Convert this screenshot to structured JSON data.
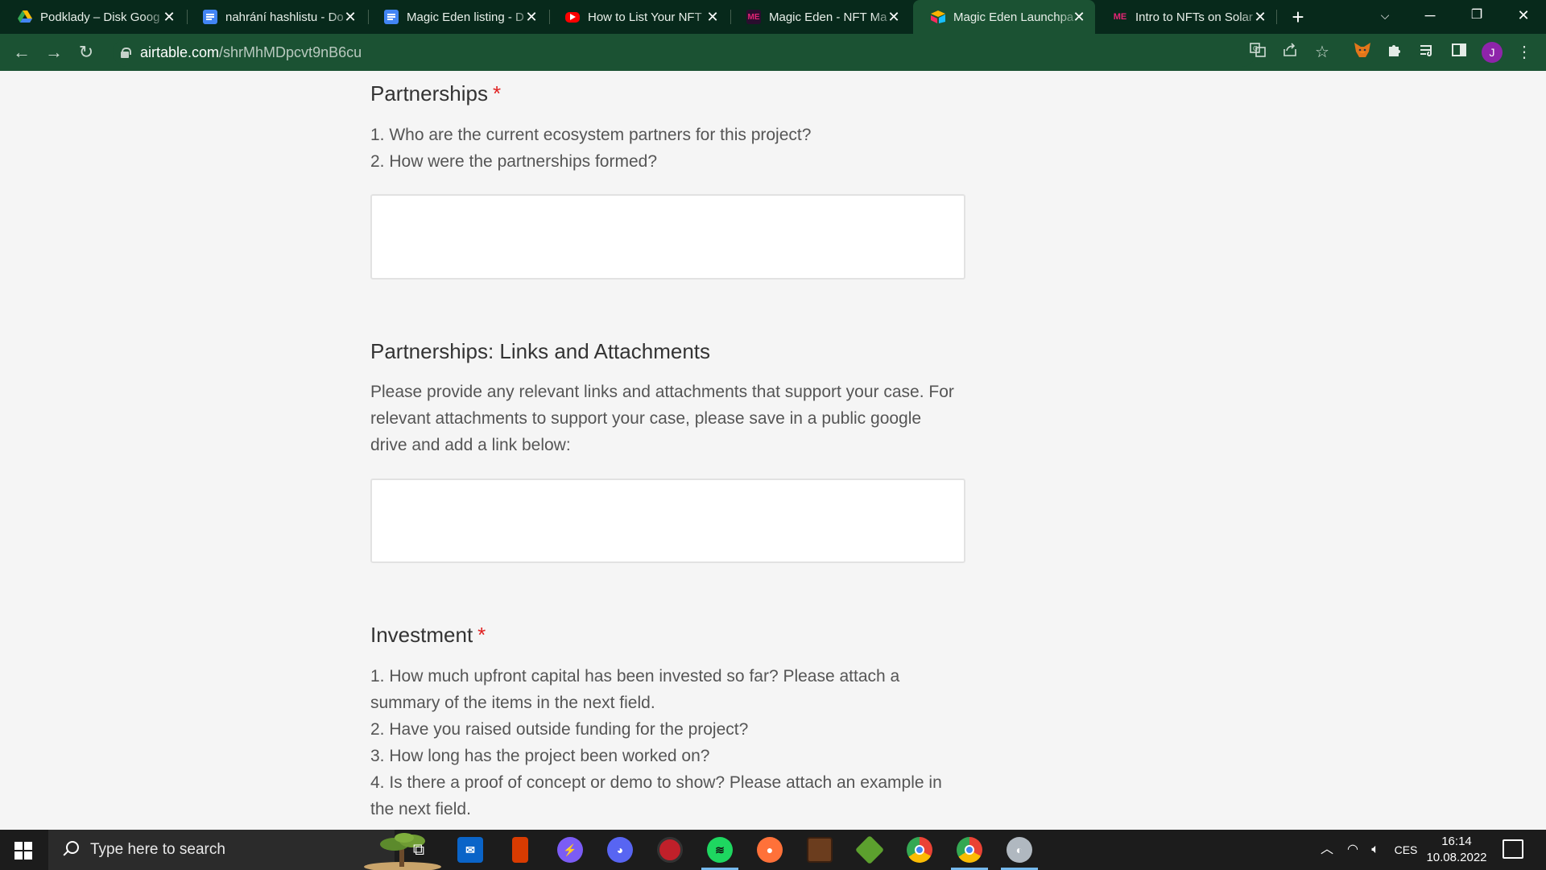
{
  "browser": {
    "tabs": [
      {
        "title": "Podklady – Disk Goog",
        "icon": "google-drive-icon",
        "active": false
      },
      {
        "title": "nahrání hashlistu - Do",
        "icon": "google-docs-icon",
        "active": false
      },
      {
        "title": "Magic Eden listing - D",
        "icon": "google-docs-icon",
        "active": false
      },
      {
        "title": "How to List Your NFT",
        "icon": "youtube-icon",
        "active": false
      },
      {
        "title": "Magic Eden - NFT Ma",
        "icon": "magic-eden-icon",
        "active": false
      },
      {
        "title": "Magic Eden Launchpa",
        "icon": "airtable-icon",
        "active": true
      },
      {
        "title": "Intro to NFTs on Solar",
        "icon": "magic-eden-icon",
        "active": false
      }
    ],
    "url_host": "airtable.com",
    "url_path": "/shrMhMDpcvt9nB6cu",
    "profile_initial": "J"
  },
  "form": {
    "partnerships": {
      "title": "Partnerships",
      "required_mark": "*",
      "lines": [
        "1. Who are the current ecosystem partners for this project?",
        "2. How were the partnerships formed?"
      ]
    },
    "partnerships_links": {
      "title": "Partnerships: Links and Attachments",
      "lines": [
        "Please provide any relevant links and attachments that support your case. For",
        "relevant attachments to support your case, please save in a public google",
        "drive and add a link below:"
      ]
    },
    "investment": {
      "title": "Investment",
      "required_mark": "*",
      "lines": [
        "1. How much upfront capital has been invested so far? Please attach a",
        "summary of the items in the next field.",
        "2. Have you raised outside funding for the project?",
        "3. How long has the project been worked on?",
        "4. Is there a proof of concept or demo to show? Please attach an example in",
        "the next field."
      ]
    }
  },
  "taskbar": {
    "search_placeholder": "Type here to search",
    "language": "CES",
    "time": "16:14",
    "date": "10.08.2022"
  },
  "colors": {
    "tabstrip_bg": "#07291b",
    "toolbar_bg": "#1b5233",
    "required": "#e02020",
    "taskbar_bg": "#1c1c1c"
  }
}
